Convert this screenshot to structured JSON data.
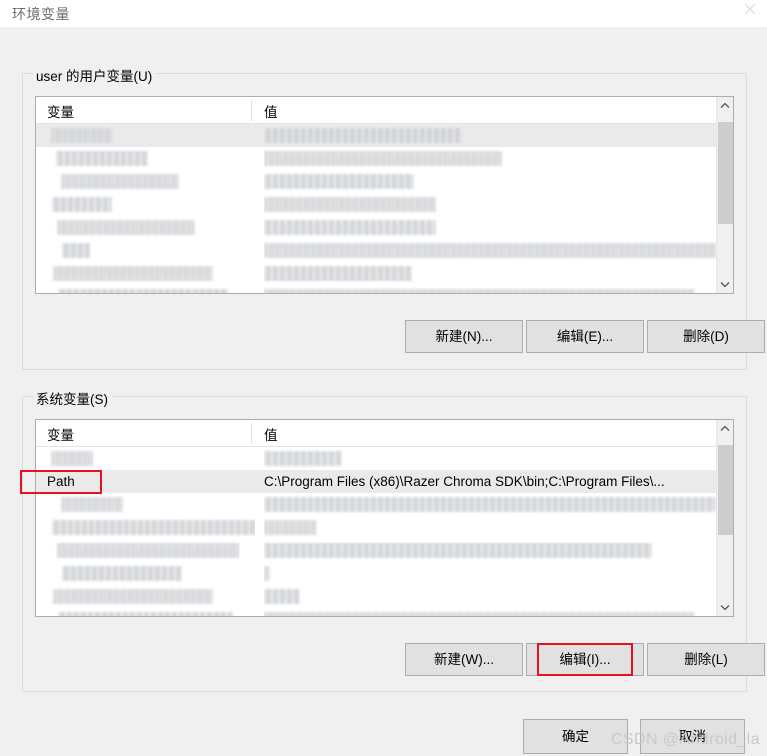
{
  "window": {
    "title": "环境变量",
    "close_icon": "close-icon"
  },
  "user_section": {
    "label": "user 的用户变量(U)",
    "columns": {
      "variable": "变量",
      "value": "值"
    },
    "rows": [
      {
        "variable": "",
        "value": "",
        "censored": true,
        "selected": true,
        "var_width": 62,
        "val_width": 198
      },
      {
        "variable": "",
        "value": "",
        "censored": true,
        "selected": false,
        "var_width": 92,
        "val_width": 238
      },
      {
        "variable": "",
        "value": "",
        "censored": true,
        "selected": false,
        "var_width": 118,
        "val_width": 150
      },
      {
        "variable": "",
        "value": "",
        "censored": true,
        "selected": false,
        "var_width": 60,
        "val_width": 172
      },
      {
        "variable": "",
        "value": "",
        "censored": true,
        "selected": false,
        "var_width": 138,
        "val_width": 172
      },
      {
        "variable": "",
        "value": "",
        "censored": true,
        "selected": false,
        "var_width": 28,
        "val_width": 452
      },
      {
        "variable": "",
        "value": "",
        "censored": true,
        "selected": false,
        "var_width": 160,
        "val_width": 148
      },
      {
        "variable": "",
        "value": "",
        "censored": true,
        "selected": false,
        "var_width": 170,
        "val_width": 430
      }
    ],
    "scrollbar": {
      "up_icon": "chevron-up-icon",
      "down_icon": "chevron-down-icon",
      "thumb_top_pct": 4,
      "thumb_height_pct": 52
    },
    "buttons": {
      "new": "新建(N)...",
      "edit": "编辑(E)...",
      "delete": "删除(D)"
    }
  },
  "system_section": {
    "label": "系统变量(S)",
    "columns": {
      "variable": "变量",
      "value": "值"
    },
    "rows": [
      {
        "variable": "",
        "value": "",
        "censored": true,
        "selected": false,
        "var_width": 42,
        "val_width": 78
      },
      {
        "variable": "Path",
        "value": "C:\\Program Files (x86)\\Razer Chroma SDK\\bin;C:\\Program Files\\...",
        "censored": false,
        "selected": true,
        "var_width": 0,
        "val_width": 0
      },
      {
        "variable": "",
        "value": "",
        "censored": true,
        "selected": false,
        "var_width": 62,
        "val_width": 452
      },
      {
        "variable": "",
        "value": "",
        "censored": true,
        "selected": false,
        "var_width": 205,
        "val_width": 52
      },
      {
        "variable": "",
        "value": "",
        "censored": true,
        "selected": false,
        "var_width": 182,
        "val_width": 388
      },
      {
        "variable": "",
        "value": "",
        "censored": true,
        "selected": false,
        "var_width": 120,
        "val_width": 6
      },
      {
        "variable": "",
        "value": "",
        "censored": true,
        "selected": false,
        "var_width": 160,
        "val_width": 36
      },
      {
        "variable": "",
        "value": "",
        "censored": true,
        "selected": false,
        "var_width": 175,
        "val_width": 430
      }
    ],
    "scrollbar": {
      "up_icon": "chevron-up-icon",
      "down_icon": "chevron-down-icon",
      "thumb_top_pct": 4,
      "thumb_height_pct": 46
    },
    "buttons": {
      "new": "新建(W)...",
      "edit": "编辑(I)...",
      "delete": "删除(L)"
    }
  },
  "footer": {
    "ok": "确定",
    "cancel": "取消"
  },
  "annotations": {
    "color": "#e81123",
    "path_highlight": "Path",
    "edit_highlight": "编辑(I)..."
  },
  "watermark": "CSDN @Android_la"
}
